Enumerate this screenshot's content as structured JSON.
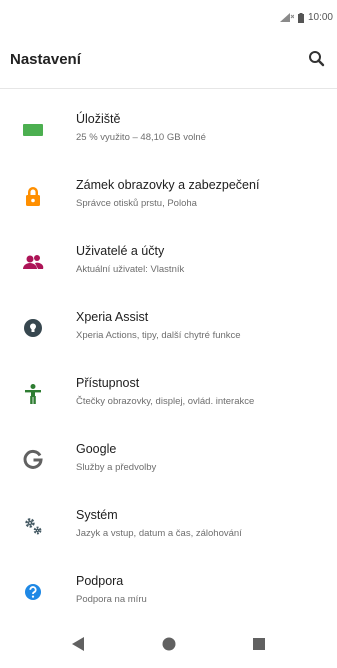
{
  "status_bar": {
    "time": "10:00",
    "icons": [
      "signal-icon",
      "battery-icon"
    ]
  },
  "app_bar": {
    "title": "Nastavení",
    "search_icon": "search-icon"
  },
  "settings": [
    {
      "title": "Úložiště",
      "subtitle": "25 % využito – 48,10 GB volné",
      "icon": "storage-icon",
      "color": "#4caf50"
    },
    {
      "title": "Zámek obrazovky a zabezpečení",
      "subtitle": "Správce otisků prstu, Poloha",
      "icon": "lock-icon",
      "color": "#ff8f00"
    },
    {
      "title": "Uživatelé a účty",
      "subtitle": "Aktuální uživatel: Vlastník",
      "icon": "users-icon",
      "color": "#ad1457"
    },
    {
      "title": "Xperia Assist",
      "subtitle": "Xperia Actions, tipy, další chytré funkce",
      "icon": "xperia-assist-icon",
      "color": "#37474f"
    },
    {
      "title": "Přístupnost",
      "subtitle": "Čtečky obrazovky, displej, ovlád. interakce",
      "icon": "accessibility-icon",
      "color": "#2e7d32"
    },
    {
      "title": "Google",
      "subtitle": "Služby a předvolby",
      "icon": "google-icon",
      "color": "#616161"
    },
    {
      "title": "Systém",
      "subtitle": "Jazyk a vstup, datum a čas, zálohování",
      "icon": "system-gear-icon",
      "color": "#455a64"
    },
    {
      "title": "Podpora",
      "subtitle": "Podpora na míru",
      "icon": "help-icon",
      "color": "#1e88e5"
    }
  ],
  "nav_bar": {
    "buttons": [
      "back-icon",
      "home-icon",
      "recents-icon"
    ],
    "color": "#616161"
  }
}
